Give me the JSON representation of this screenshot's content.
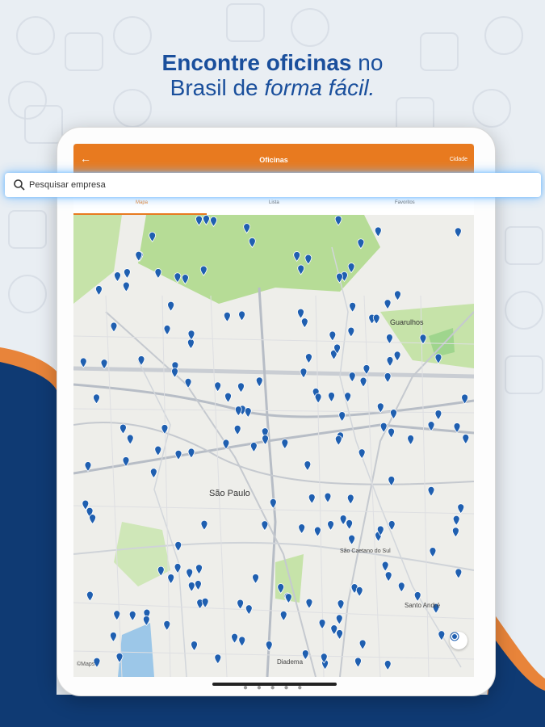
{
  "headline": {
    "line1_bold_start": "Encontre",
    "line1_bold": "oficinas",
    "line1_end": "no",
    "line2_start": "Brasil de",
    "line2_italic": "forma fácil."
  },
  "app": {
    "back_icon": "arrow-left-icon",
    "title": "Oficinas",
    "city_button": "Cidade",
    "tabs": [
      {
        "label": "Mapa",
        "active": true
      },
      {
        "label": "Lista",
        "active": false
      },
      {
        "label": "Favoritos",
        "active": false
      }
    ]
  },
  "search": {
    "placeholder": "Pesquisar empresa",
    "icon": "search-icon"
  },
  "map": {
    "labels": {
      "city_main": "São Paulo",
      "guarulhos": "Guarulhos",
      "sao_caetano": "São Caetano do Sul",
      "santo_andre": "Santo André",
      "diadema": "Diadema"
    },
    "attribution": "©Maps",
    "marker_count": 180,
    "colors": {
      "marker": "#1f5fb0",
      "park": "#b6dc96",
      "road_major": "#b7bdc6",
      "water": "#9cc7e8"
    }
  },
  "pager_dots": "● ● ● ● ●",
  "brand_colors": {
    "primary_blue": "#1a4f9c",
    "accent_orange": "#e87a1f",
    "navy": "#0f3a73"
  }
}
